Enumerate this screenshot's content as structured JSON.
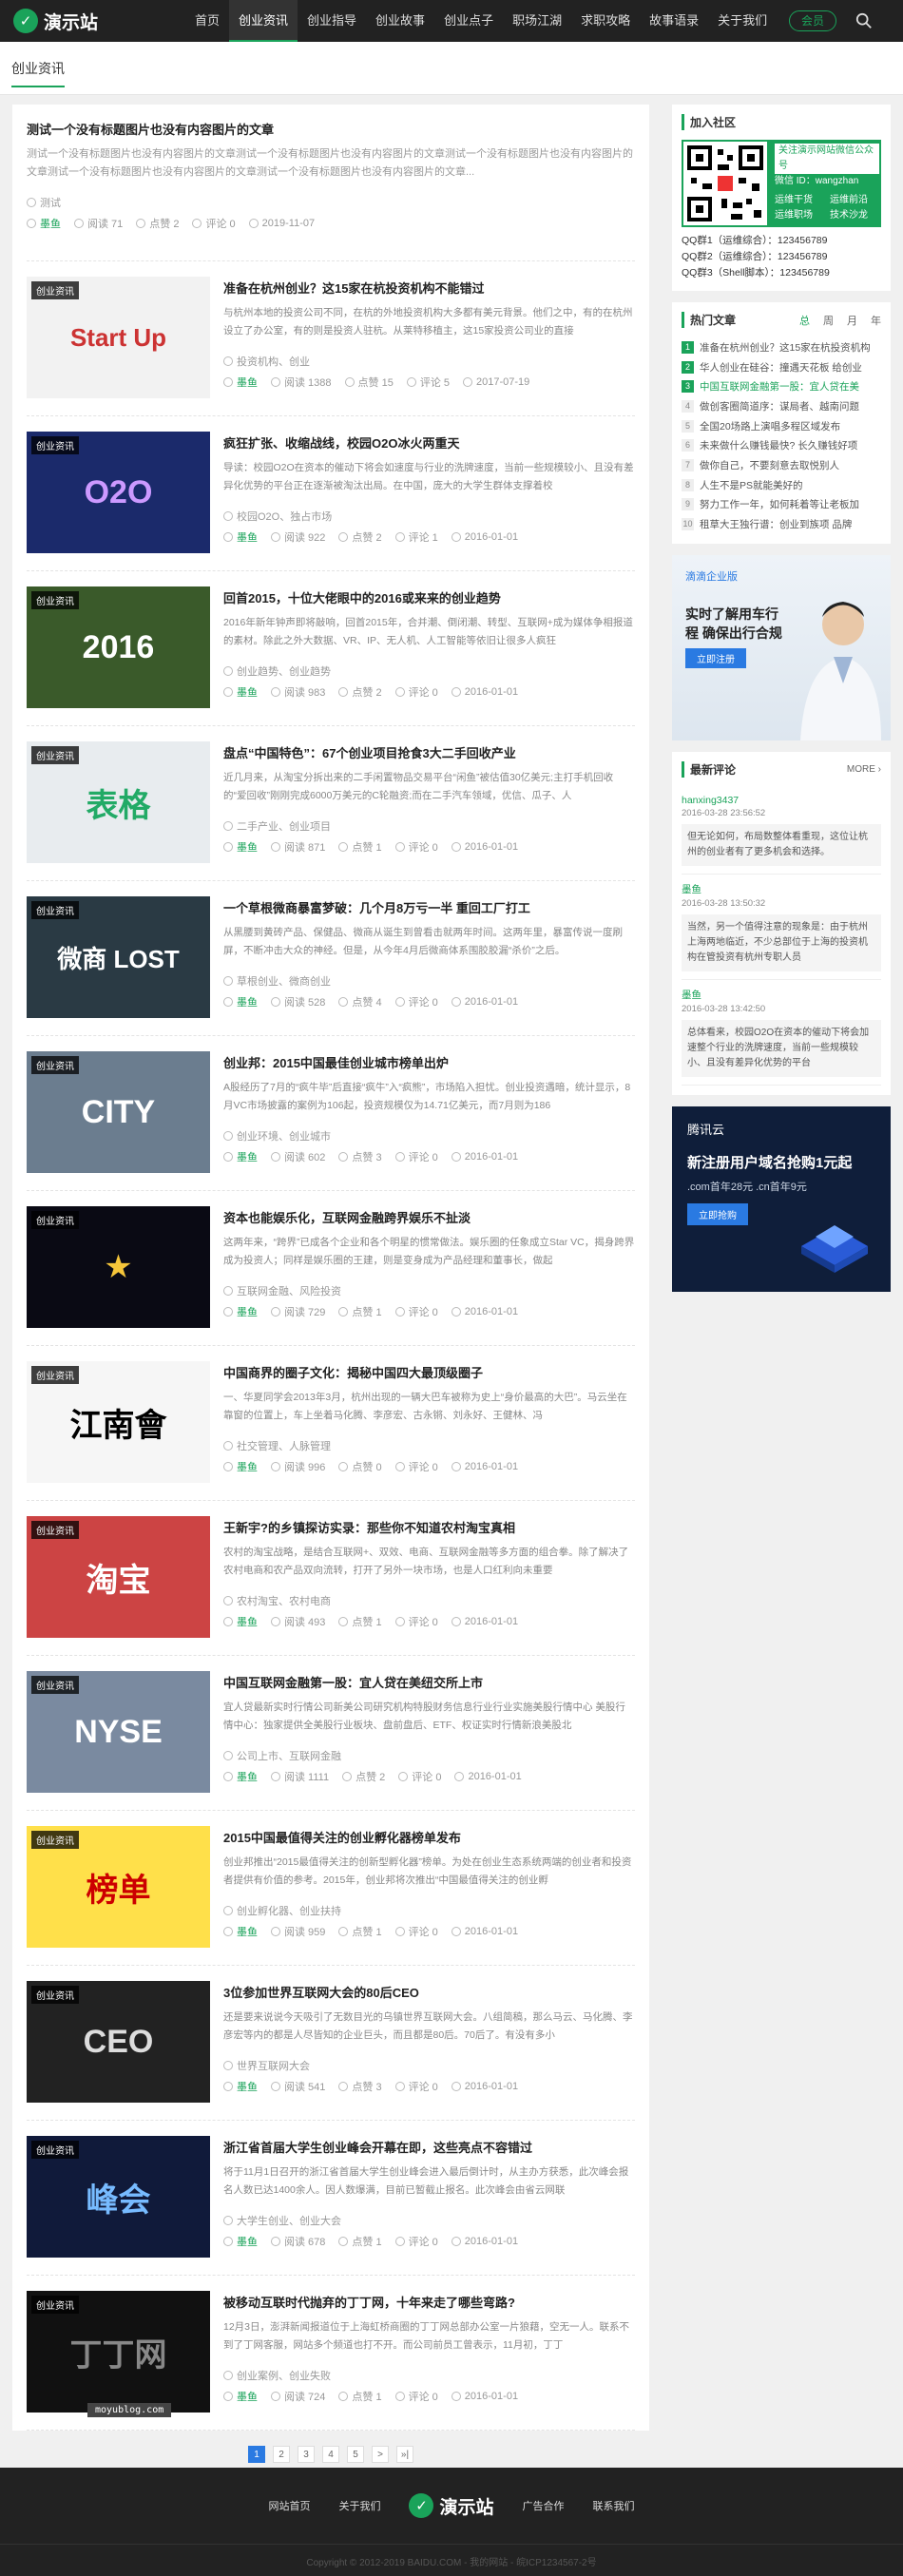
{
  "header": {
    "logo": "演示站",
    "nav": [
      "首页",
      "创业资讯",
      "创业指导",
      "创业故事",
      "创业点子",
      "职场江湖",
      "求职攻略",
      "故事语录",
      "关于我们"
    ],
    "member": "会员"
  },
  "breadcrumb": "创业资讯",
  "top_article": {
    "title": "测试一个没有标题图片也没有内容图片的文章",
    "excerpt": "测试一个没有标题图片也没有内容图片的文章测试一个没有标题图片也没有内容图片的文章测试一个没有标题图片也没有内容图片的文章测试一个没有标题图片也没有内容图片的文章测试一个没有标题图片也没有内容图片的文章...",
    "tags": "测试",
    "author": "墨鱼",
    "views": "阅读 71",
    "likes": "点赞 2",
    "comments": "评论 0",
    "date": "2019-11-07"
  },
  "articles": [
    {
      "category": "创业资讯",
      "title": "准备在杭州创业？这15家在杭投资机构不能错过",
      "excerpt": "与杭州本地的投资公司不同，在杭的外地投资机构大多都有美元背景。他们之中，有的在杭州设立了办公室，有的则是投资人驻杭。从莱特移植主，这15家投资公司业的直接",
      "tags": "投资机构、创业",
      "author": "墨鱼",
      "views": "阅读 1388",
      "likes": "点赞 15",
      "comments": "评论 5",
      "date": "2017-07-19"
    },
    {
      "category": "创业资讯",
      "title": "疯狂扩张、收缩战线，校园O2O冰火两重天",
      "excerpt": "导读：校园O2O在资本的催动下将会如速度与行业的洗牌速度，当前一些规模较小、且没有差异化优势的平台正在逐渐被淘汰出局。在中国，庞大的大学生群体支撑着校",
      "tags": "校园O2O、独占市场",
      "author": "墨鱼",
      "views": "阅读 922",
      "likes": "点赞 2",
      "comments": "评论 1",
      "date": "2016-01-01"
    },
    {
      "category": "创业资讯",
      "title": "回首2015，十位大佬眼中的2016或来来的创业趋势",
      "excerpt": "2016年新年钟声即将敲响，回首2015年，合并潮、倒闭潮、转型、互联网+成为媒体争相报道的素材。除此之外大数据、VR、IP、无人机、人工智能等依旧让很多人疯狂",
      "tags": "创业趋势、创业趋势",
      "author": "墨鱼",
      "views": "阅读 983",
      "likes": "点赞 2",
      "comments": "评论 0",
      "date": "2016-01-01"
    },
    {
      "category": "创业资讯",
      "title": "盘点“中国特色”：67个创业项目抢食3大二手回收产业",
      "excerpt": "近几月来，从淘宝分拆出来的二手闲置物品交易平台“闲鱼”被估值30亿美元;主打手机回收的“爱回收”刚刚完成6000万美元的C轮融资;而在二手汽车领域，优信、瓜子、人",
      "tags": "二手产业、创业项目",
      "author": "墨鱼",
      "views": "阅读 871",
      "likes": "点赞 1",
      "comments": "评论 0",
      "date": "2016-01-01"
    },
    {
      "category": "创业资讯",
      "title": "一个草根微商暴富梦破：几个月8万亏一半 重回工厂打工",
      "excerpt": "从黑腰到黄砖产品、保健品、微商从诞生到曾看击就两年时间。这两年里，暴富传说一度刷屏，不断冲击大众的神经。但是，从今年4月后微商体系围胶胶漏“杀价”之后。",
      "tags": "草根创业、微商创业",
      "author": "墨鱼",
      "views": "阅读 528",
      "likes": "点赞 4",
      "comments": "评论 0",
      "date": "2016-01-01"
    },
    {
      "category": "创业资讯",
      "title": "创业邦：2015中国最佳创业城市榜单出炉",
      "excerpt": "A股经历了7月的“疯牛毕”后直接“疯牛”入“疯熊”，市场陷入担忧。创业投资遇暗，统计显示，8月VC市场披露的案例为106起，投资规模仅为14.71亿美元，而7月则为186",
      "tags": "创业环境、创业城市",
      "author": "墨鱼",
      "views": "阅读 602",
      "likes": "点赞 3",
      "comments": "评论 0",
      "date": "2016-01-01"
    },
    {
      "category": "创业资讯",
      "title": "资本也能娱乐化，互联网金融跨界娱乐不扯淡",
      "excerpt": "这两年来，“跨界”已成各个企业和各个明星的惯常做法。娱乐圈的任象成立Star VC，揭身跨界成为投资人；同样是娱乐圈的王建，则是变身成为产品经理和董事长，做起",
      "tags": "互联网金融、风险投资",
      "author": "墨鱼",
      "views": "阅读 729",
      "likes": "点赞 1",
      "comments": "评论 0",
      "date": "2016-01-01"
    },
    {
      "category": "创业资讯",
      "title": "中国商界的圈子文化：揭秘中国四大最顶级圈子",
      "excerpt": "一、华夏同学会2013年3月，杭州出现的一辆大巴车被称为史上“身价最高的大巴”。马云坐在靠窗的位置上，车上坐着马化腾、李彦宏、古永锵、刘永好、王健林、冯",
      "tags": "社交管理、人脉管理",
      "author": "墨鱼",
      "views": "阅读 996",
      "likes": "点赞 0",
      "comments": "评论 0",
      "date": "2016-01-01"
    },
    {
      "category": "创业资讯",
      "title": "王新宇?的乡镇探访实录：那些你不知道农村淘宝真相",
      "excerpt": "农村的淘宝战略，是结合互联网+、双效、电商、互联网金融等多方面的组合拳。除了解决了农村电商和农产品双向流转，打开了另外一块市场，也是人口红利向未重要",
      "tags": "农村淘宝、农村电商",
      "author": "墨鱼",
      "views": "阅读 493",
      "likes": "点赞 1",
      "comments": "评论 0",
      "date": "2016-01-01"
    },
    {
      "category": "创业资讯",
      "title": "中国互联网金融第一股：宜人贷在美纽交所上市",
      "excerpt": "宜人贷最新实时行情公司新美公司研究机构特股财务信息行业行业实施美股行情中心 美股行情中心：独家提供全美股行业板块、盘前盘后、ETF、权证实时行情新浪美股北",
      "tags": "公司上市、互联网金融",
      "author": "墨鱼",
      "views": "阅读 1111",
      "likes": "点赞 2",
      "comments": "评论 0",
      "date": "2016-01-01"
    },
    {
      "category": "创业资讯",
      "title": "2015中国最值得关注的创业孵化器榜单发布",
      "excerpt": "创业邦推出“2015最值得关注的创新型孵化器”榜单。为处在创业生态系统两端的创业者和投资者提供有价值的参考。2015年，创业邦将次推出“中国最值得关注的创业孵",
      "tags": "创业孵化器、创业扶持",
      "author": "墨鱼",
      "views": "阅读 959",
      "likes": "点赞 1",
      "comments": "评论 0",
      "date": "2016-01-01"
    },
    {
      "category": "创业资讯",
      "title": "3位参加世界互联网大会的80后CEO",
      "excerpt": "还是要来说说今天吸引了无数目光的乌镇世界互联网大会。八组简稿，那么马云、马化腾、李彦宏等内的都是人尽皆知的企业巨头，而且都是80后。70后了。有没有多小",
      "tags": "世界互联网大会",
      "author": "墨鱼",
      "views": "阅读 541",
      "likes": "点赞 3",
      "comments": "评论 0",
      "date": "2016-01-01"
    },
    {
      "category": "创业资讯",
      "title": "浙江省首届大学生创业峰会开幕在即，这些亮点不容错过",
      "excerpt": "将于11月1日召开的浙江省首届大学生创业峰会进入最后倒计时，从主办方获悉，此次峰会报名人数已达1400余人。因人数爆满，目前已暂截止报名。此次峰会由省云网联",
      "tags": "大学生创业、创业大会",
      "author": "墨鱼",
      "views": "阅读 678",
      "likes": "点赞 1",
      "comments": "评论 0",
      "date": "2016-01-01"
    },
    {
      "category": "创业资讯",
      "title": "被移动互联时代抛弃的丁丁网，十年来走了哪些弯路?",
      "excerpt": "12月3日，澎湃新闻报道位于上海虹桥商圈的丁丁网总部办公室一片狼藉，空无一人。联系不到了丁网客服，网站多个频道也打不开。而公司前员工曾表示，11月初，丁丁",
      "tags": "创业案例、创业失败",
      "author": "墨鱼",
      "views": "阅读 724",
      "likes": "点赞 1",
      "comments": "评论 0",
      "date": "2016-01-01"
    }
  ],
  "watermark": "moyublog.com",
  "pagination": [
    "1",
    "2",
    "3",
    "4",
    "5",
    ">",
    "»|"
  ],
  "sidebar": {
    "join": {
      "title": "加入社区",
      "qr_title": "关注演示网站微信公众号",
      "wechat": "微信 ID：wangzhan",
      "features": [
        "运维干货",
        "运维前沿",
        "运维职场",
        "技术沙龙"
      ],
      "qq": [
        "QQ群1（运维综合）：123456789",
        "QQ群2（运维综合）：123456789",
        "QQ群3（Shell脚本）：123456789"
      ]
    },
    "hot": {
      "title": "热门文章",
      "tabs": [
        "总",
        "周",
        "月",
        "年"
      ],
      "items": [
        "准备在杭州创业？这15家在杭投资机构",
        "华人创业在硅谷：撞遇天花板 给创业",
        "中国互联网金融第一股：宜人贷在美",
        "做创客圈简道序：谋局者、越南问题",
        "全国20场路上演唱多程区域发布",
        "未来做什么赚钱最快? 长久赚钱好项",
        "做你自己，不要刻意去取悦别人",
        "人生不是PS就能美好的",
        "努力工作一年，如何耗着等让老板加",
        "租草大王独行谱：创业到族项 品牌"
      ]
    },
    "ad1": {
      "brand": "滴滴企业版",
      "headline": "实时了解用车行程 确保出行合规",
      "button": "立即注册"
    },
    "comments": {
      "title": "最新评论",
      "more": "MORE ›",
      "items": [
        {
          "user": "hanxing3437",
          "date": "2016-03-28 23:56:52",
          "text": "但无论如何，布局数整体看重现，这位让杭州的创业者有了更多机会和选择。"
        },
        {
          "user": "墨鱼",
          "date": "2016-03-28 13:50:32",
          "text": "当然，另一个值得注意的现象是：由于杭州上海两地临近，不少总部位于上海的投资机构在管投资有杭州专职人员"
        },
        {
          "user": "墨鱼",
          "date": "2016-03-28 13:42:50",
          "text": "总体看来，校园O2O在资本的催动下将会加速整个行业的洗牌速度，当前一些规模较小、且没有差异化优势的平台"
        }
      ]
    },
    "ad2": {
      "brand": "腾讯云",
      "headline": "新注册用户域名抢购1元起",
      "sub": ".com首年28元 .cn首年9元",
      "button": "立即抢购"
    }
  },
  "footer": {
    "links": [
      "网站首页",
      "关于我们",
      "广告合作",
      "联系我们"
    ],
    "logo": "演示站",
    "copyright": "Copyright © 2012-2019 BAIDU.COM - 我的网站 - 皖ICP1234567-2号"
  }
}
